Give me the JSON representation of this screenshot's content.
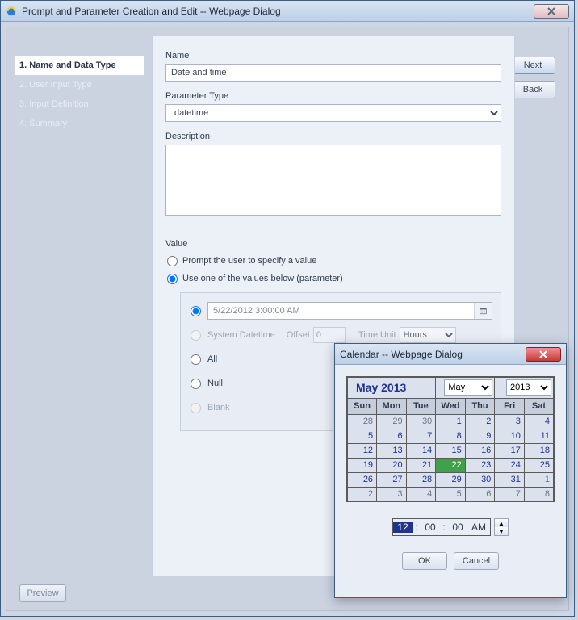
{
  "window": {
    "title": "Prompt and Parameter Creation and Edit -- Webpage Dialog"
  },
  "steps": {
    "s1": "1. Name and Data Type",
    "s2": "2. User Input Type",
    "s3": "3. Input Definition",
    "s4": "4. Summary"
  },
  "buttons": {
    "next": "Next",
    "back": "Back",
    "preview": "Preview"
  },
  "form": {
    "name_label": "Name",
    "name_value": "Date and time",
    "type_label": "Parameter Type",
    "type_value": "datetime",
    "desc_label": "Description",
    "desc_value": "",
    "value_label": "Value",
    "prompt_opt": "Prompt the user to specify a value",
    "use_opt": "Use one of the values below (parameter)",
    "date_value": "5/22/2012 3:00:00 AM",
    "sysdt": "System Datetime",
    "offset_lbl": "Offset",
    "offset_val": "0",
    "timeunit_lbl": "Time Unit",
    "timeunit_val": "Hours",
    "all": "All",
    "null": "Null",
    "blank": "Blank"
  },
  "calendar": {
    "title": "Calendar -- Webpage Dialog",
    "month_label": "May 2013",
    "month_sel": "May",
    "year_sel": "2013",
    "dow": {
      "0": "Sun",
      "1": "Mon",
      "2": "Tue",
      "3": "Wed",
      "4": "Thu",
      "5": "Fri",
      "6": "Sat"
    },
    "rows": [
      {
        "c": [
          {
            "d": "28",
            "off": true
          },
          {
            "d": "29",
            "off": true
          },
          {
            "d": "30",
            "off": true
          },
          {
            "d": "1"
          },
          {
            "d": "2"
          },
          {
            "d": "3"
          },
          {
            "d": "4"
          }
        ]
      },
      {
        "c": [
          {
            "d": "5"
          },
          {
            "d": "6"
          },
          {
            "d": "7"
          },
          {
            "d": "8"
          },
          {
            "d": "9"
          },
          {
            "d": "10"
          },
          {
            "d": "11"
          }
        ]
      },
      {
        "c": [
          {
            "d": "12"
          },
          {
            "d": "13"
          },
          {
            "d": "14"
          },
          {
            "d": "15"
          },
          {
            "d": "16"
          },
          {
            "d": "17"
          },
          {
            "d": "18"
          }
        ]
      },
      {
        "c": [
          {
            "d": "19"
          },
          {
            "d": "20"
          },
          {
            "d": "21"
          },
          {
            "d": "22",
            "today": true
          },
          {
            "d": "23"
          },
          {
            "d": "24"
          },
          {
            "d": "25"
          }
        ]
      },
      {
        "c": [
          {
            "d": "26"
          },
          {
            "d": "27"
          },
          {
            "d": "28"
          },
          {
            "d": "29"
          },
          {
            "d": "30"
          },
          {
            "d": "31"
          },
          {
            "d": "1",
            "off": true
          }
        ]
      },
      {
        "c": [
          {
            "d": "2",
            "off": true
          },
          {
            "d": "3",
            "off": true
          },
          {
            "d": "4",
            "off": true
          },
          {
            "d": "5",
            "off": true
          },
          {
            "d": "6",
            "off": true
          },
          {
            "d": "7",
            "off": true
          },
          {
            "d": "8",
            "off": true
          }
        ]
      }
    ],
    "time": {
      "hh": "12",
      "mm": "00",
      "ss": "00",
      "ampm": "AM"
    },
    "ok": "OK",
    "cancel": "Cancel"
  }
}
